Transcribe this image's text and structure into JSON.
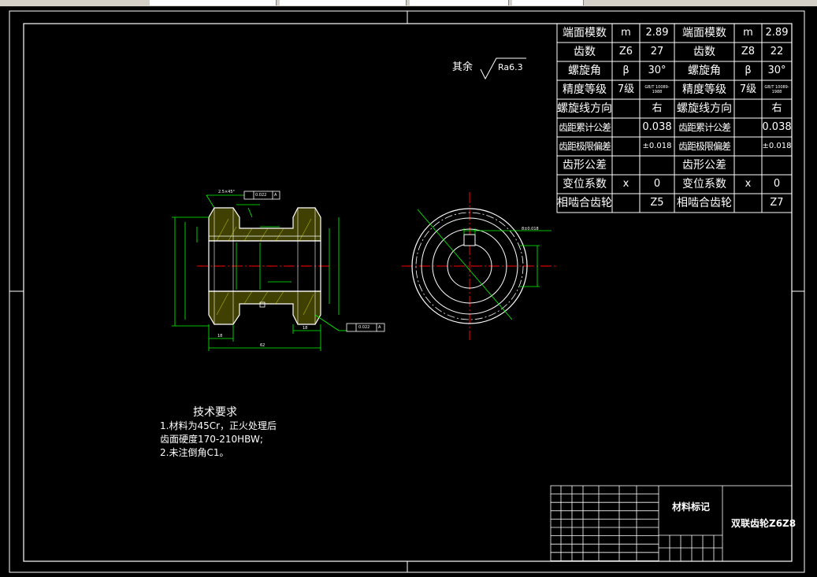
{
  "tables": {
    "left": [
      {
        "label": "端面模数",
        "sym": "m",
        "val": "2.89"
      },
      {
        "label": "齿数",
        "sym": "Z6",
        "val": "27"
      },
      {
        "label": "螺旋角",
        "sym": "β",
        "val": "30°"
      },
      {
        "label": "精度等级",
        "sym": "7级",
        "val": "GB/T 10089-1988"
      },
      {
        "label": "螺旋线方向",
        "sym": "",
        "val": "右"
      },
      {
        "label": "齿距累计公差",
        "sym": "",
        "val": "0.038"
      },
      {
        "label": "齿距极限偏差",
        "sym": "",
        "val": "±0.018"
      },
      {
        "label": "齿形公差",
        "sym": "",
        "val": ""
      },
      {
        "label": "变位系数",
        "sym": "x",
        "val": "0"
      },
      {
        "label": "相啮合齿轮",
        "sym": "",
        "val": "Z5"
      }
    ],
    "right": [
      {
        "label": "端面模数",
        "sym": "m",
        "val": "2.89"
      },
      {
        "label": "齿数",
        "sym": "Z8",
        "val": "22"
      },
      {
        "label": "螺旋角",
        "sym": "β",
        "val": "30°"
      },
      {
        "label": "精度等级",
        "sym": "7级",
        "val": "GB/T 10089-1988"
      },
      {
        "label": "螺旋线方向",
        "sym": "",
        "val": "右"
      },
      {
        "label": "齿距累计公差",
        "sym": "",
        "val": "0.038"
      },
      {
        "label": "齿距极限偏差",
        "sym": "",
        "val": "±0.018"
      },
      {
        "label": "齿形公差",
        "sym": "",
        "val": ""
      },
      {
        "label": "变位系数",
        "sym": "x",
        "val": "0"
      },
      {
        "label": "相啮合齿轮",
        "sym": "",
        "val": "Z7"
      }
    ]
  },
  "roughness": {
    "prefix": "其余",
    "value": "Ra6.3"
  },
  "requirements": {
    "title": "技术要求",
    "lines": [
      "1.材料为45Cr，正火处理后",
      "齿面硬度170-210HBW;",
      "2.未注倒角C1。"
    ]
  },
  "titleblock": {
    "material": "材料标记",
    "name": "双联齿轮Z6Z8"
  },
  "dims": {
    "chamfer": "2.5×45°",
    "runout": "0.022",
    "datum": "A",
    "key_width": "8±0.018",
    "len_a": "18",
    "len_total": "62",
    "len_b": "18"
  },
  "colors": {
    "line": "#ffffff",
    "green": "#00ff00",
    "red": "#ff0000",
    "yellow": "#ffff00",
    "bg": "#000000"
  }
}
